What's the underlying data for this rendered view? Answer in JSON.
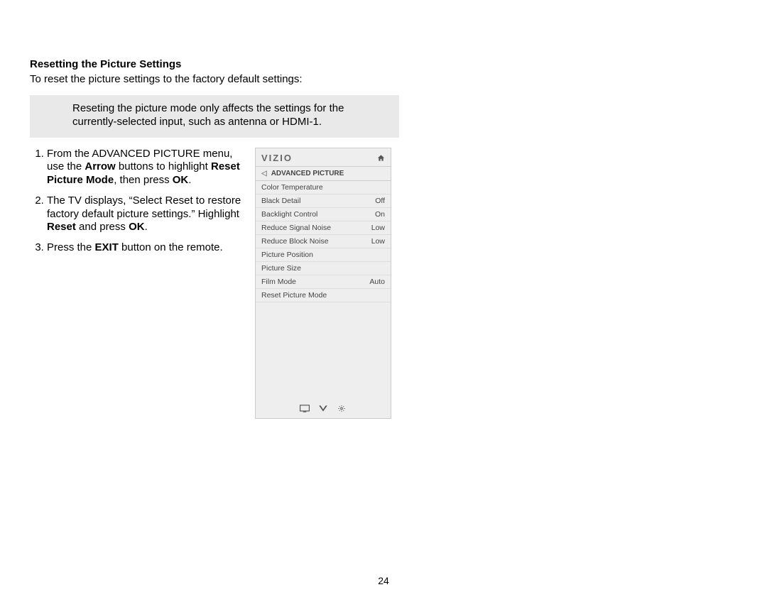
{
  "heading": "Resetting the Picture Settings",
  "intro": "To reset the picture settings to the factory default settings:",
  "note": "Reseting the picture mode only affects the settings for the currently-selected input, such as antenna or HDMI-1.",
  "steps": {
    "s1a": "From the ADVANCED PICTURE menu, use the ",
    "s1b": "Arrow",
    "s1c": " buttons to highlight ",
    "s1d": "Reset Picture Mode",
    "s1e": ", then press ",
    "s1f": "OK",
    "s1g": ".",
    "s2a": "The TV displays, “Select Reset to restore factory default picture settings.” Highlight ",
    "s2b": "Reset",
    "s2c": " and press ",
    "s2d": "OK",
    "s2e": ".",
    "s3a": "Press the ",
    "s3b": "EXIT",
    "s3c": " button on the remote."
  },
  "tv": {
    "logo": "VIZIO",
    "breadcrumb": "ADVANCED PICTURE",
    "rows": [
      {
        "label": "Color Temperature",
        "value": ""
      },
      {
        "label": "Black Detail",
        "value": "Off"
      },
      {
        "label": "Backlight Control",
        "value": "On"
      },
      {
        "label": "Reduce Signal Noise",
        "value": "Low"
      },
      {
        "label": "Reduce Block Noise",
        "value": "Low"
      },
      {
        "label": "Picture Position",
        "value": ""
      },
      {
        "label": "Picture Size",
        "value": ""
      },
      {
        "label": "Film Mode",
        "value": "Auto"
      },
      {
        "label": "Reset Picture Mode",
        "value": ""
      }
    ]
  },
  "page_number": "24"
}
